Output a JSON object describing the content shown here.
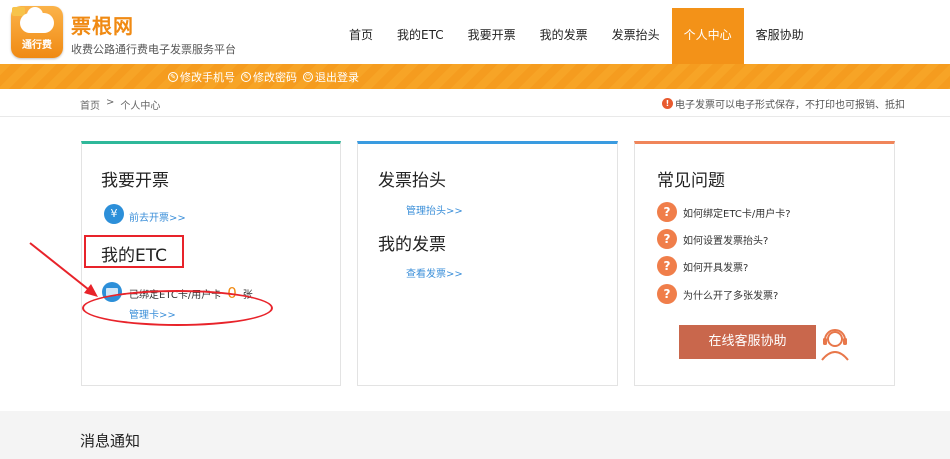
{
  "header": {
    "logo_text": "通行费",
    "brand": "票根网",
    "subtitle": "收费公路通行费电子发票服务平台",
    "nav": [
      {
        "label": "首页"
      },
      {
        "label": "我的ETC"
      },
      {
        "label": "我要开票"
      },
      {
        "label": "我的发票"
      },
      {
        "label": "发票抬头"
      },
      {
        "label": "个人中心",
        "active": true
      },
      {
        "label": "客服协助"
      }
    ],
    "accent_color": "#f39218"
  },
  "strip": {
    "links": [
      {
        "label": "修改手机号"
      },
      {
        "label": "修改密码"
      },
      {
        "label": "退出登录"
      }
    ]
  },
  "breadcrumb": {
    "home": "首页",
    "sep": ">",
    "current": "个人中心"
  },
  "notice": {
    "icon": "!",
    "text": "电子发票可以电子形式保存，不打印也可报销、抵扣"
  },
  "cards": {
    "invoice": {
      "title": "我要开票",
      "link": "前去开票>>",
      "etc_title": "我的ETC",
      "bound_prefix": "已绑定ETC卡/用户卡",
      "bound_count": "0",
      "bound_unit": "张",
      "manage_link": "管理卡>>"
    },
    "header": {
      "title": "发票抬头",
      "manage_link": "管理抬头>>",
      "my_invoice_title": "我的发票",
      "view_link": "查看发票>>"
    },
    "faq": {
      "title": "常见问题",
      "items": [
        {
          "q": "如何绑定ETC卡/用户卡?"
        },
        {
          "q": "如何设置发票抬头?"
        },
        {
          "q": "如何开具发票?"
        },
        {
          "q": "为什么开了多张发票?"
        }
      ],
      "service_button": "在线客服协助"
    }
  },
  "bottom": {
    "title": "消息通知"
  },
  "colors": {
    "orange": "#f39218",
    "teal_border": "#2fb89a",
    "blue_border": "#3a9be0",
    "coral_border": "#f0855a",
    "link_blue": "#3b8fd9",
    "annotation_red": "#e8232a"
  },
  "icons": {
    "yen": "¥",
    "faq": "?"
  }
}
